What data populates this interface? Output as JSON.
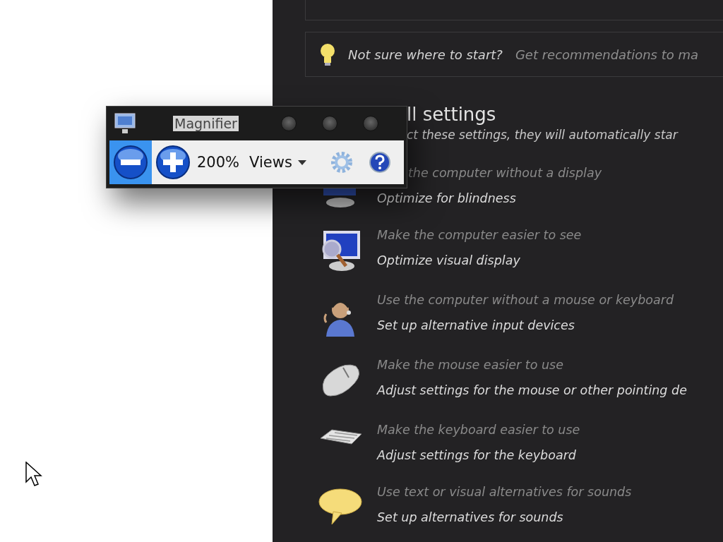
{
  "tip": {
    "lead": "Not sure where to start?",
    "link": "Get recommendations to ma"
  },
  "heading": "ll settings",
  "subtitle": "ct these settings, they will automatically star",
  "settings": [
    {
      "kind": "partly-covered",
      "caption": "the computer without a display",
      "action": "Optimize for blindness"
    },
    {
      "kind": "full",
      "caption": "Make the computer easier to see",
      "action": "Optimize visual display"
    },
    {
      "kind": "full",
      "caption": "Use the computer without a mouse or keyboard",
      "action": "Set up alternative input devices"
    },
    {
      "kind": "full",
      "caption": "Make the mouse easier to use",
      "action": "Adjust settings for the mouse or other pointing de"
    },
    {
      "kind": "full",
      "caption": "Make the keyboard easier to use",
      "action": "Adjust settings for the keyboard"
    },
    {
      "kind": "full",
      "caption": "Use text or visual alternatives for sounds",
      "action": "Set up alternatives for sounds"
    }
  ],
  "magnifier": {
    "title": "Magnifier",
    "zoom": "200%",
    "views": "Views"
  }
}
